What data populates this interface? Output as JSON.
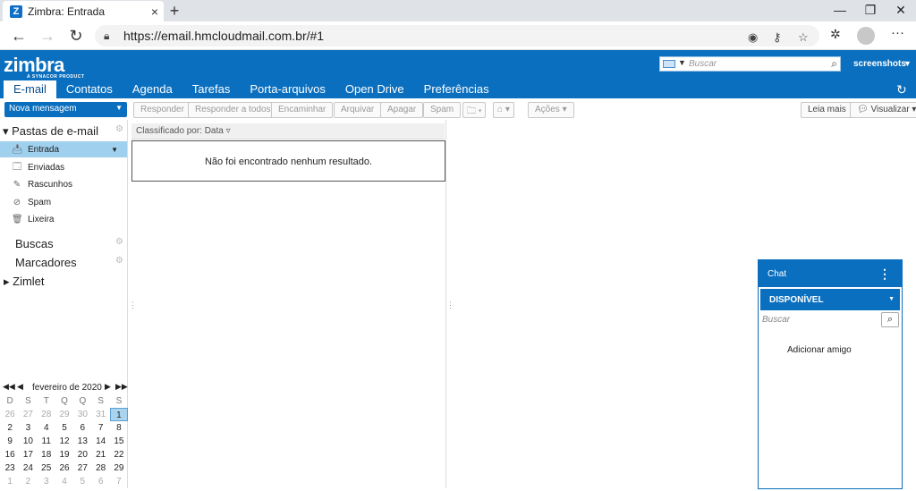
{
  "browser": {
    "tab_title": "Zimbra: Entrada",
    "tab_icon_letter": "Z",
    "url": "https://email.hmcloudmail.com.br/#1"
  },
  "header": {
    "logo": "zimbra",
    "logo_sub": "A SYNACOR PRODUCT",
    "search_placeholder": "Buscar",
    "username": "screenshots"
  },
  "app_tabs": [
    "E-mail",
    "Contatos",
    "Agenda",
    "Tarefas",
    "Porta-arquivos",
    "Open Drive",
    "Preferências"
  ],
  "toolbar": {
    "new_message": "Nova mensagem",
    "reply": "Responder",
    "reply_all": "Responder a todos",
    "forward": "Encaminhar",
    "archive": "Arquivar",
    "delete": "Apagar",
    "spam": "Spam",
    "actions": "Ações",
    "read_more": "Leia mais",
    "view": "Visualizar"
  },
  "sidebar": {
    "mail_folders": "Pastas de e-mail",
    "folders": [
      {
        "label": "Entrada",
        "icon": "inbox-icon"
      },
      {
        "label": "Enviadas",
        "icon": "sent-icon"
      },
      {
        "label": "Rascunhos",
        "icon": "drafts-icon"
      },
      {
        "label": "Spam",
        "icon": "spam-icon"
      },
      {
        "label": "Lixeira",
        "icon": "trash-icon"
      }
    ],
    "searches": "Buscas",
    "tags": "Marcadores",
    "zimlets": "Zimlet"
  },
  "calendar": {
    "month": "fevereiro de 2020",
    "dow": [
      "D",
      "S",
      "T",
      "Q",
      "Q",
      "S",
      "S"
    ],
    "rows": [
      [
        "26",
        "27",
        "28",
        "29",
        "30",
        "31",
        "1"
      ],
      [
        "2",
        "3",
        "4",
        "5",
        "6",
        "7",
        "8"
      ],
      [
        "9",
        "10",
        "11",
        "12",
        "13",
        "14",
        "15"
      ],
      [
        "16",
        "17",
        "18",
        "19",
        "20",
        "21",
        "22"
      ],
      [
        "23",
        "24",
        "25",
        "26",
        "27",
        "28",
        "29"
      ],
      [
        "1",
        "2",
        "3",
        "4",
        "5",
        "6",
        "7"
      ]
    ]
  },
  "list": {
    "sort_label": "Classificado por: Data",
    "empty": "Não foi encontrado nenhum resultado."
  },
  "chat": {
    "title": "Chat",
    "status": "DISPONÍVEL",
    "search_placeholder": "Buscar",
    "add_friend": "Adicionar amigo"
  }
}
